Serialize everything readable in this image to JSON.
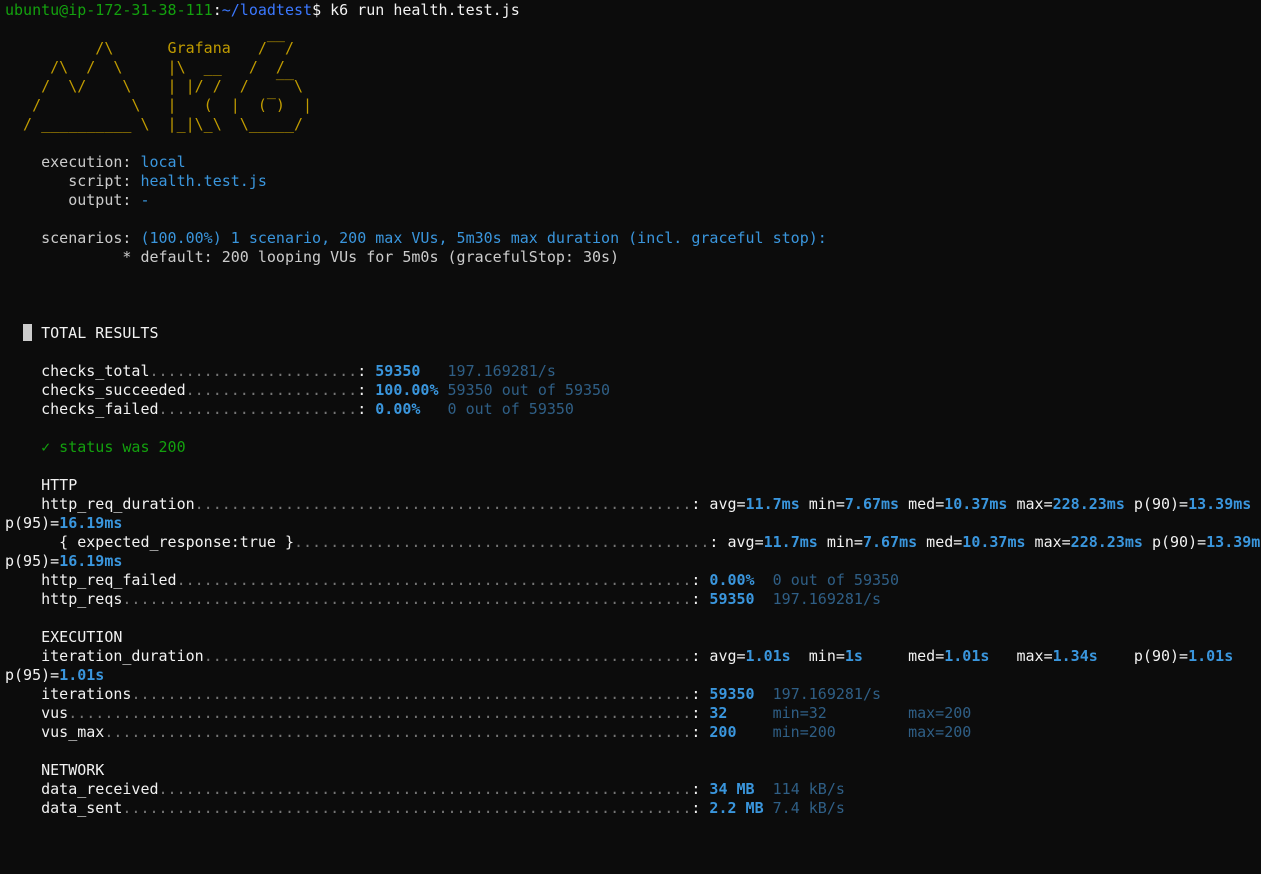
{
  "prompt": {
    "user_host": "ubuntu@ip-172-31-38-111",
    "sep": ":",
    "path": "~/loadtest",
    "symbol": "$",
    "command": " k6 run health.test.js"
  },
  "banner": [
    "          /\\      Grafana   /‾‾/  ",
    "     /\\  /  \\     |\\  __   /  /   ",
    "    /  \\/    \\    | |/ /  /   ‾‾\\ ",
    "   /          \\   |   (  |  (‾)  |",
    "  / __________ \\  |_|\\_\\  \\_____/ "
  ],
  "info": {
    "execution_label": "    execution: ",
    "execution_value": "local",
    "script_label": "       script: ",
    "script_value": "health.test.js",
    "output_label": "       output: ",
    "output_value": "-",
    "scenarios_label": "    scenarios: ",
    "scenarios_value": "(100.00%) 1 scenario, 200 max VUs, 5m30s max duration (incl. graceful stop):",
    "scenario_default": "             * default: 200 looping VUs for 5m0s (gracefulStop: 30s)"
  },
  "total_results": {
    "title": "TOTAL RESULTS",
    "checks": [
      {
        "name": "checks_total",
        "dots": ".......................",
        "value": "59350  ",
        "extra": " 197.169281/s"
      },
      {
        "name": "checks_succeeded",
        "dots": "...................",
        "value": "100.00%",
        "extra": " 59350 out of 59350"
      },
      {
        "name": "checks_failed",
        "dots": "......................",
        "value": "0.00%  ",
        "extra": " 0 out of 59350"
      }
    ],
    "check_status": "✓ status was 200"
  },
  "http": {
    "title": "HTTP",
    "req_duration": {
      "name": "http_req_duration",
      "dots": ".......................................................",
      "avg": "11.7ms",
      "min": "7.67ms",
      "med": "10.37ms",
      "max": "228.23ms",
      "p90": "13.39ms",
      "p95": "16.19ms"
    },
    "expected": {
      "name": "  { expected_response:true }",
      "dots": "..............................................",
      "avg": "11.7ms",
      "min": "7.67ms",
      "med": "10.37ms",
      "max": "228.23ms",
      "p90": "13.39ms",
      "p95": "16.19ms"
    },
    "req_failed": {
      "name": "http_req_failed",
      "dots": ".........................................................",
      "value": "0.00% ",
      "extra": " 0 out of 59350"
    },
    "reqs": {
      "name": "http_reqs",
      "dots": "...............................................................",
      "value": "59350 ",
      "extra": " 197.169281/s"
    }
  },
  "execution": {
    "title": "EXECUTION",
    "iteration_duration": {
      "name": "iteration_duration",
      "dots": "......................................................",
      "avg": "1.01s",
      "min": "1s",
      "med": "1.01s",
      "max": "1.34s",
      "p90": "1.01s",
      "p95": "1.01s"
    },
    "iterations": {
      "name": "iterations",
      "dots": "..............................................................",
      "value": "59350 ",
      "extra": " 197.169281/s"
    },
    "vus": {
      "name": "vus",
      "dots": ".....................................................................",
      "value": "32    ",
      "extra_min": " min=32",
      "extra_max": "max=200"
    },
    "vus_max": {
      "name": "vus_max",
      "dots": ".................................................................",
      "value": "200   ",
      "extra_min": " min=200",
      "extra_max": "max=200"
    }
  },
  "network": {
    "title": "NETWORK",
    "data_received": {
      "name": "data_received",
      "dots": "...........................................................",
      "value": "34 MB ",
      "extra": " 114 kB/s"
    },
    "data_sent": {
      "name": "data_sent",
      "dots": "...............................................................",
      "value": "2.2 MB",
      "extra": " 7.4 kB/s"
    }
  }
}
